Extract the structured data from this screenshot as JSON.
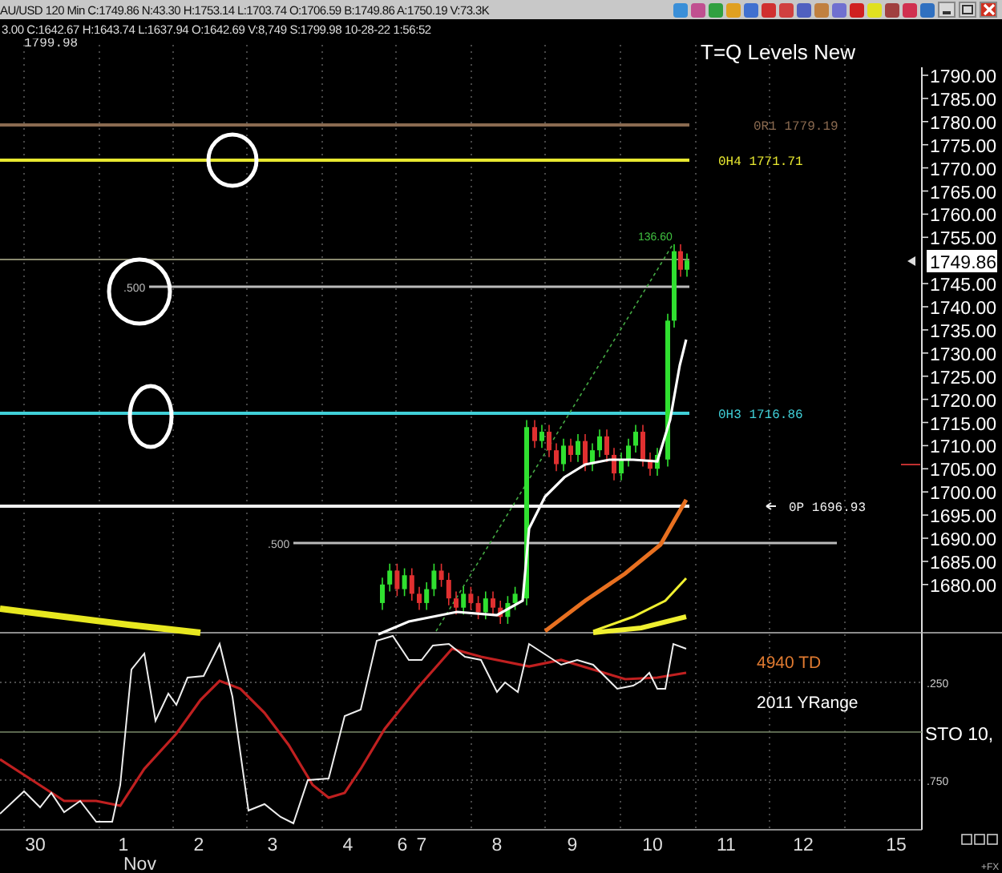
{
  "title_bar": {
    "quote": "AU/USD 120 Min C:1749.86 N:43.30 H:1753.14 L:1703.74 O:1706.59 B:1749.86 A:1750.19 V:73.3K"
  },
  "info_bar": {
    "text": "3.00 C:1642.67 H:1643.74 L:1637.94 O:1642.69 V:8,749 S:1799.98 10-28-22 1:56:52"
  },
  "chart": {
    "title": "T=Q Levels New",
    "top_price": "1799.98",
    "price_axis": [
      "1790.00",
      "1785.00",
      "1780.00",
      "1775.00",
      "1770.00",
      "1765.00",
      "1760.00",
      "1755.00",
      "1745.00",
      "1740.00",
      "1735.00",
      "1730.00",
      "1725.00",
      "1720.00",
      "1715.00",
      "1710.00",
      "1705.00",
      "1700.00",
      "1695.00",
      "1690.00",
      "1685.00",
      "1680.00"
    ],
    "last_price": "1749.86",
    "levels": [
      {
        "label": "0R1 1779.19",
        "color": "#8a6a50"
      },
      {
        "label": "0H4 1771.71",
        "color": "#e8e830"
      },
      {
        "label": "0H3 1716.86",
        "color": "#40d0d8"
      },
      {
        "label": "0P 1696.93",
        "color": "#f0f0f0"
      }
    ],
    "fib_labels": [
      ".500",
      ".500"
    ],
    "range_label": "136.60"
  },
  "indicator": {
    "legend": [
      {
        "label": "4940 TD",
        "color": "#e07a30"
      },
      {
        "label": "2011 YRange",
        "color": "#ffffff"
      }
    ],
    "axis": [
      ".250",
      ".750"
    ],
    "name": "STO 10,"
  },
  "x_axis": {
    "labels": [
      "30",
      "1",
      "2",
      "3",
      "4",
      "6",
      "7",
      "8",
      "9",
      "10",
      "11",
      "12",
      "15"
    ],
    "month": "Nov"
  },
  "footer": "+FX"
}
